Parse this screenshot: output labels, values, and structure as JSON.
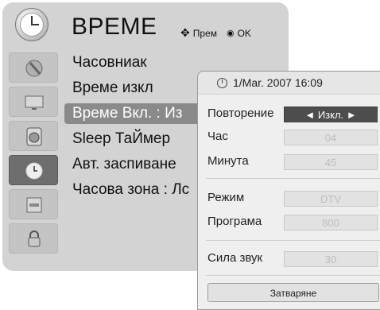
{
  "header": {
    "title": "ВРЕМЕ",
    "hint_move": "Прем",
    "hint_ok": "OK"
  },
  "sidebar": {
    "items": [
      {
        "icon": "picture-icon"
      },
      {
        "icon": "monitor-icon"
      },
      {
        "icon": "speaker-icon"
      },
      {
        "icon": "clock-icon",
        "active": true
      },
      {
        "icon": "settings-icon"
      },
      {
        "icon": "lock-icon"
      }
    ]
  },
  "menu": {
    "items": [
      {
        "label": "Часовниак"
      },
      {
        "label": "Време изкл"
      },
      {
        "label": "Време Вкл. : Из",
        "selected": true
      },
      {
        "label": "Sleep ТаЙмер"
      },
      {
        "label": "Авт. заспиване"
      },
      {
        "label": "Часова зона : Лс"
      }
    ]
  },
  "popup": {
    "datetime": "1/Mar. 2007 16:09",
    "rows": [
      {
        "label": "Повторение",
        "value": "◄ Изкл. ►",
        "active": true
      },
      {
        "label": "Час",
        "value": "04"
      },
      {
        "label": "Минута",
        "value": "45"
      },
      {
        "label": "Режим",
        "value": "DTV"
      },
      {
        "label": "Програма",
        "value": "800"
      },
      {
        "label": "Сила звук",
        "value": "30"
      }
    ],
    "close_label": "Затваряне"
  }
}
